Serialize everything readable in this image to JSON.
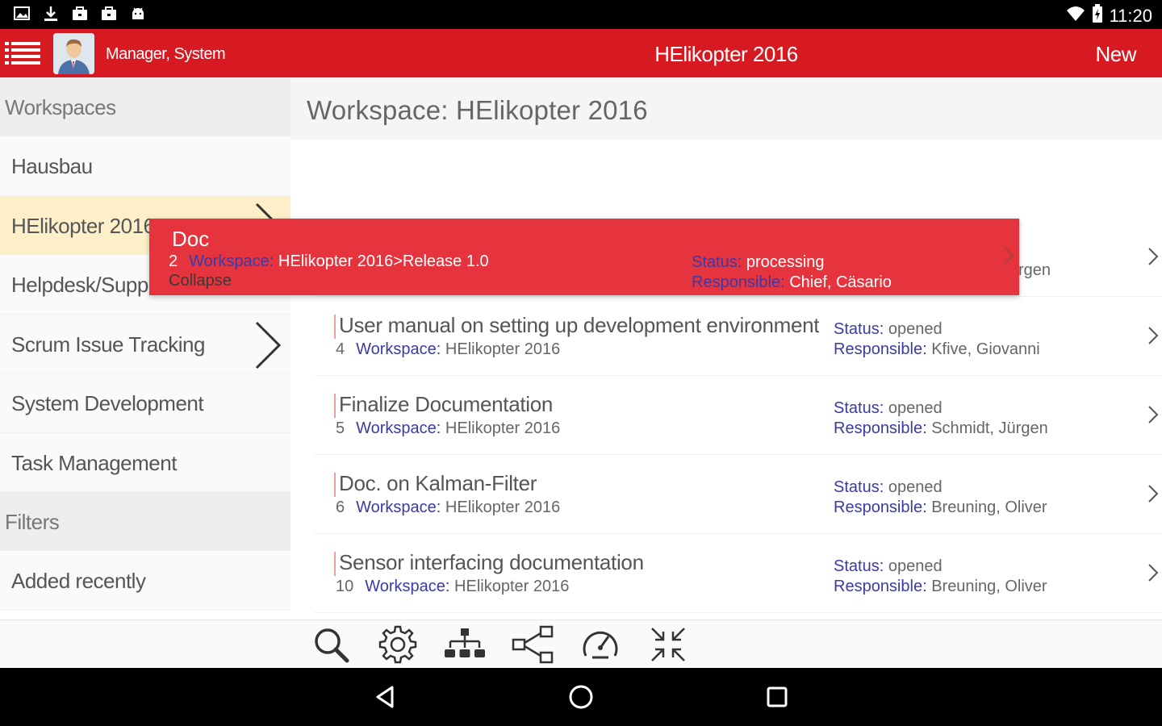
{
  "status_bar": {
    "time": "11:20",
    "left_icons": [
      "image-icon",
      "download-icon",
      "briefcase-icon",
      "briefcase-icon",
      "android-icon"
    ],
    "right_icons": [
      "wifi-icon",
      "battery-icon"
    ]
  },
  "header": {
    "user_name": "Manager, System",
    "title": "HElikopter 2016",
    "new_label": "New",
    "accent_color": "#d71921"
  },
  "sidebar": {
    "workspaces_header": "Workspaces",
    "items": [
      {
        "label": "Hausbau",
        "selected": false,
        "chevron": false
      },
      {
        "label": "HElikopter 2016",
        "selected": true,
        "chevron": true
      },
      {
        "label": "Helpdesk/Support",
        "selected": false,
        "chevron": false
      },
      {
        "label": "Scrum Issue Tracking",
        "selected": false,
        "chevron": true
      },
      {
        "label": "System Development",
        "selected": false,
        "chevron": false
      },
      {
        "label": "Task Management",
        "selected": false,
        "chevron": false
      }
    ],
    "filters_header": "Filters",
    "filter_items": [
      {
        "label": "Added recently"
      }
    ]
  },
  "main": {
    "workspace_title": "Workspace: HElikopter 2016",
    "hidden_row_fragment": "rgen",
    "popup": {
      "title": "Doc",
      "number": "2",
      "workspace_key": "Workspace:",
      "workspace_value": "HElikopter 2016>Release 1.0",
      "status_key": "Status:",
      "status_value": "processing",
      "responsible_key": "Responsible:",
      "responsible_value": "Chief, Cäsario",
      "collapse_label": "Collapse"
    },
    "rows": [
      {
        "title": "User manual on setting up development environment",
        "number": "4",
        "workspace_key": "Workspace:",
        "workspace_value": "HElikopter 2016",
        "status_key": "Status:",
        "status_value": "opened",
        "responsible_key": "Responsible:",
        "responsible_value": "Kfive, Giovanni"
      },
      {
        "title": "Finalize Documentation",
        "number": "5",
        "workspace_key": "Workspace:",
        "workspace_value": "HElikopter 2016",
        "status_key": "Status:",
        "status_value": "opened",
        "responsible_key": "Responsible:",
        "responsible_value": "Schmidt, Jürgen"
      },
      {
        "title": "Doc. on Kalman-Filter",
        "number": "6",
        "workspace_key": "Workspace:",
        "workspace_value": "HElikopter 2016",
        "status_key": "Status:",
        "status_value": "opened",
        "responsible_key": "Responsible:",
        "responsible_value": "Breuning, Oliver"
      },
      {
        "title": "Sensor interfacing documentation",
        "number": "10",
        "workspace_key": "Workspace:",
        "workspace_value": "HElikopter 2016",
        "status_key": "Status:",
        "status_value": "opened",
        "responsible_key": "Responsible:",
        "responsible_value": "Breuning, Oliver"
      }
    ]
  },
  "toolbar": {
    "tools": [
      "search-icon",
      "settings-icon",
      "hierarchy-icon",
      "share-icon",
      "dashboard-icon",
      "collapse-icon"
    ]
  },
  "nav_bar": {
    "buttons": [
      "back-icon",
      "home-icon",
      "recents-icon"
    ]
  }
}
